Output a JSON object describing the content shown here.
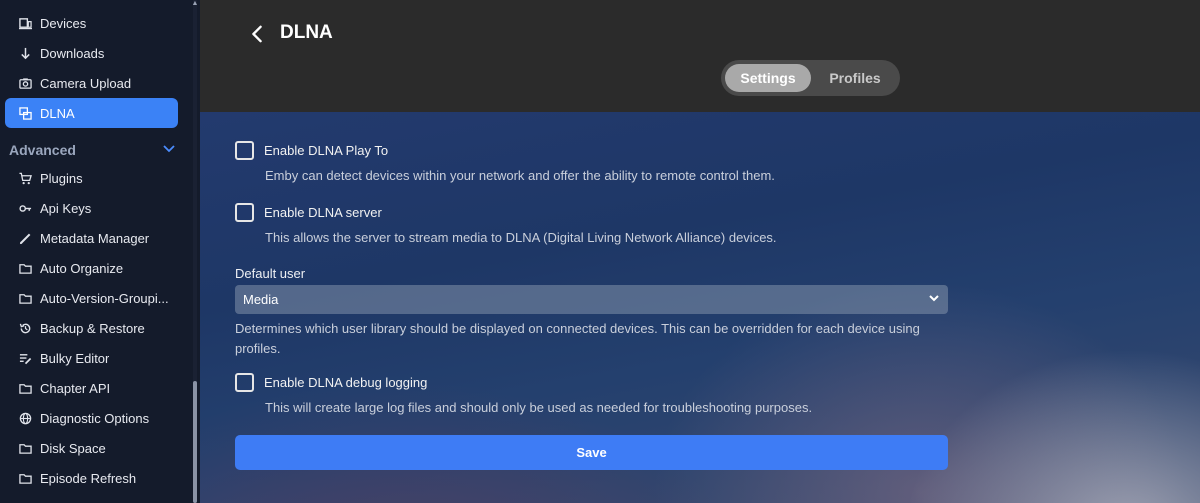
{
  "sidebar": {
    "items_top": [
      {
        "label": "Devices",
        "icon": "devices-icon"
      },
      {
        "label": "Downloads",
        "icon": "download-icon"
      },
      {
        "label": "Camera Upload",
        "icon": "camera-icon"
      },
      {
        "label": "DLNA",
        "icon": "dlna-icon",
        "active": true
      }
    ],
    "section_title": "Advanced",
    "items_advanced": [
      {
        "label": "Plugins",
        "icon": "cart-icon"
      },
      {
        "label": "Api Keys",
        "icon": "key-icon"
      },
      {
        "label": "Metadata Manager",
        "icon": "pencil-icon"
      },
      {
        "label": "Auto Organize",
        "icon": "folder-icon"
      },
      {
        "label": "Auto-Version-Groupi...",
        "icon": "folder-icon"
      },
      {
        "label": "Backup & Restore",
        "icon": "restore-icon"
      },
      {
        "label": "Bulky Editor",
        "icon": "edit-list-icon"
      },
      {
        "label": "Chapter API",
        "icon": "folder-icon"
      },
      {
        "label": "Diagnostic Options",
        "icon": "globe-icon"
      },
      {
        "label": "Disk Space",
        "icon": "folder-icon"
      },
      {
        "label": "Episode Refresh",
        "icon": "folder-icon"
      }
    ]
  },
  "header": {
    "title": "DLNA",
    "tabs": [
      {
        "label": "Settings",
        "selected": true
      },
      {
        "label": "Profiles",
        "selected": false
      }
    ]
  },
  "settings": {
    "play_to": {
      "label": "Enable DLNA Play To",
      "checked": false,
      "description": "Emby can detect devices within your network and offer the ability to remote control them."
    },
    "server": {
      "label": "Enable DLNA server",
      "checked": false,
      "description": "This allows the server to stream media to DLNA (Digital Living Network Alliance) devices."
    },
    "default_user": {
      "label": "Default user",
      "value": "Media",
      "description": "Determines which user library should be displayed on connected devices. This can be overridden for each device using profiles."
    },
    "debug_logging": {
      "label": "Enable DLNA debug logging",
      "checked": false,
      "description": "This will create large log files and should only be used as needed for troubleshooting purposes."
    },
    "save_label": "Save"
  },
  "colors": {
    "accent": "#3b82f6",
    "save_button": "#3e7cf5",
    "sidebar_bg": "#141b2b",
    "header_bg": "#2b2b2b"
  }
}
